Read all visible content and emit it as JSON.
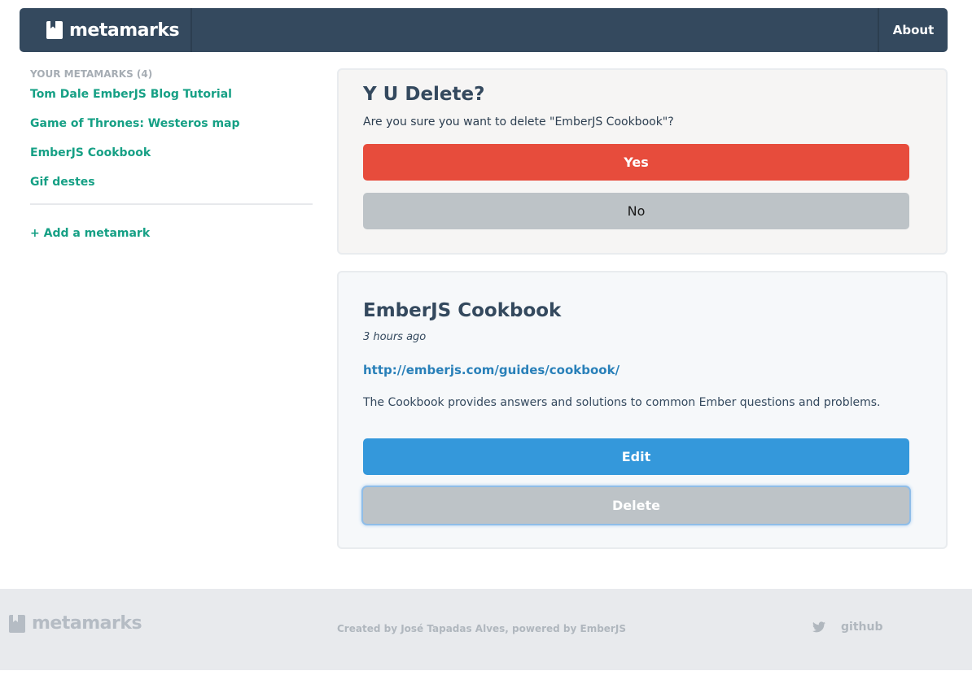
{
  "navbar": {
    "brand": "metamarks",
    "about_label": "About"
  },
  "sidebar": {
    "heading": "YOUR METAMARKS (4)",
    "items": [
      {
        "label": "Tom Dale EmberJS Blog Tutorial"
      },
      {
        "label": "Game of Thrones: Westeros map"
      },
      {
        "label": "EmberJS Cookbook"
      },
      {
        "label": "Gif destes"
      }
    ],
    "add_label": "+ Add a metamark"
  },
  "confirm": {
    "title": "Y U Delete?",
    "question": "Are you sure you want to delete \"EmberJS Cookbook\"?",
    "yes_label": "Yes",
    "no_label": "No"
  },
  "detail": {
    "title": "EmberJS Cookbook",
    "time": "3 hours ago",
    "url": "http://emberjs.com/guides/cookbook/",
    "description": "The Cookbook provides answers and solutions to common Ember questions and problems.",
    "edit_label": "Edit",
    "delete_label": "Delete"
  },
  "footer": {
    "brand": "metamarks",
    "credit": "Created by José Tapadas Alves, powered by EmberJS",
    "github_label": "github"
  },
  "icons": {
    "brand": "bookmark-box-icon",
    "twitter": "twitter-icon"
  },
  "colors": {
    "navbar": "#34495e",
    "link": "#16a085",
    "danger": "#e74c3c",
    "primary": "#3498db",
    "neutral": "#bdc3c7"
  }
}
